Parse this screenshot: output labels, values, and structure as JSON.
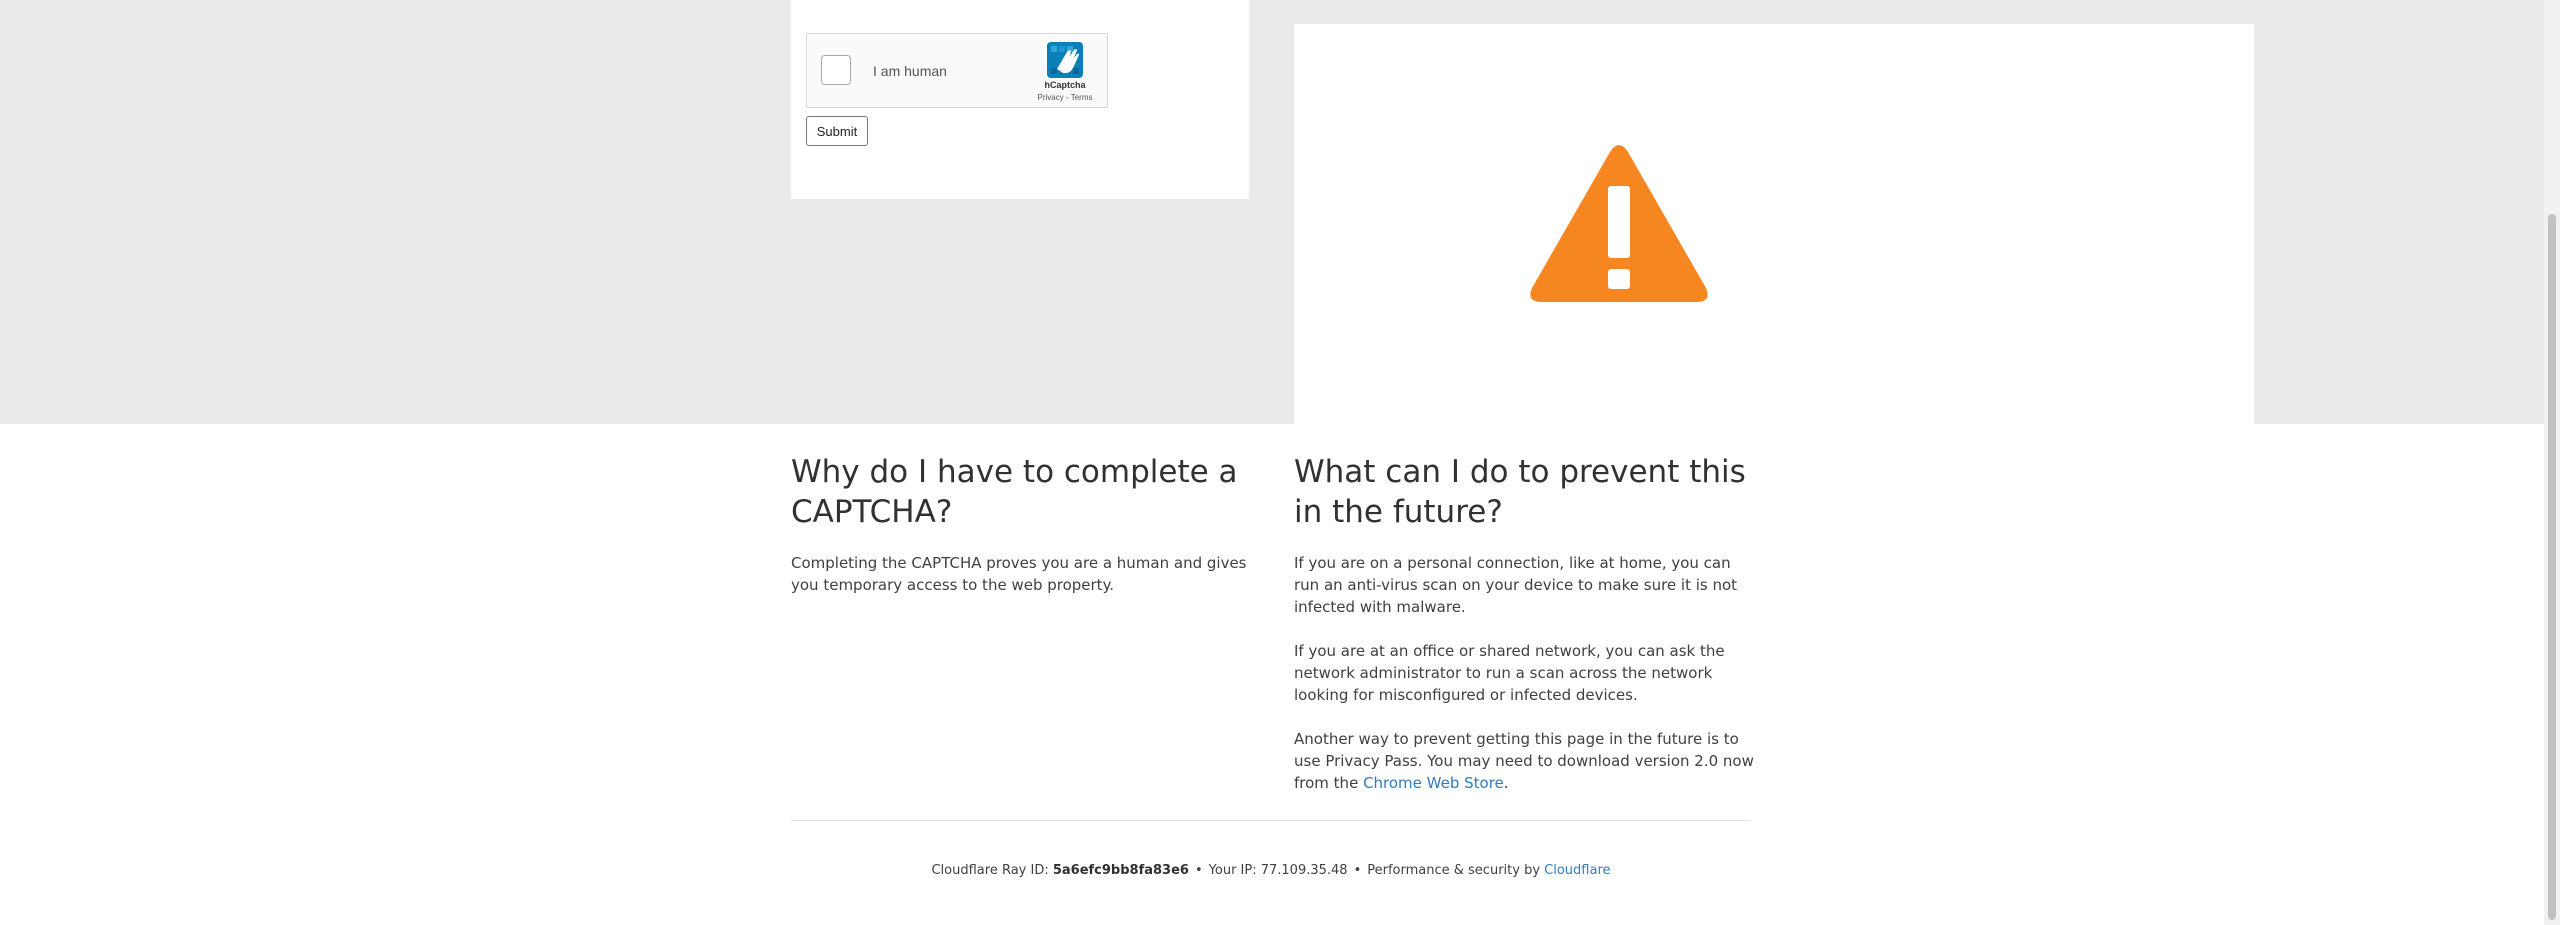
{
  "captcha_widget": {
    "checkbox_label": "I am human",
    "brand": "hCaptcha",
    "privacy_link": "Privacy",
    "link_separator": " - ",
    "terms_link": "Terms"
  },
  "form": {
    "submit_label": "Submit"
  },
  "warning": {
    "icon": "warning-triangle-icon",
    "color": "#f6861f"
  },
  "why_section": {
    "heading": "Why do I have to complete a CAPTCHA?",
    "body": "Completing the CAPTCHA proves you are a human and gives you temporary access to the web property."
  },
  "prevent_section": {
    "heading": "What can I do to prevent this in the future?",
    "paragraph1": "If you are on a personal connection, like at home, you can run an anti-virus scan on your device to make sure it is not infected with malware.",
    "paragraph2": "If you are at an office or shared network, you can ask the network administrator to run a scan across the network looking for misconfigured or infected devices.",
    "paragraph3_text": "Another way to prevent getting this page in the future is to use Privacy Pass. You may need to download version 2.0 now from the ",
    "paragraph3_link": "Chrome Web Store",
    "paragraph3_end": "."
  },
  "footer": {
    "ray_label": "Cloudflare Ray ID: ",
    "ray_id": "5a6efc9bb8fa83e6",
    "bullet": "•",
    "ip_label": "Your IP: ",
    "ip": "77.109.35.48",
    "perf_label": "Performance & security by ",
    "cloudflare_link": "Cloudflare"
  },
  "colors": {
    "link": "#2f7bbf",
    "band": "#eaeaea",
    "hcaptcha_brand": "#0074bf"
  }
}
